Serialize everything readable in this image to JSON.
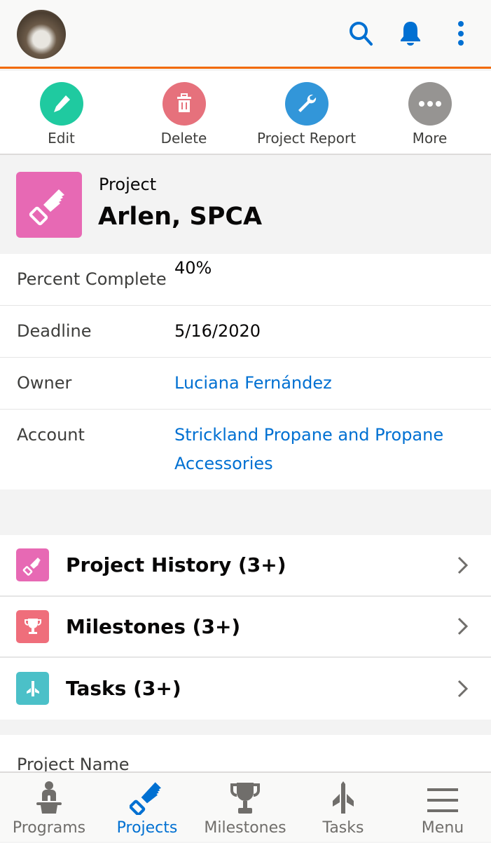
{
  "header": {
    "avatar": "user-avatar-cat",
    "icons": [
      "search-icon",
      "bell-icon",
      "more-vertical-icon"
    ],
    "accent": "#0070d2",
    "bar_color": "#f26a00"
  },
  "actions": [
    {
      "label": "Edit",
      "icon": "pencil-icon",
      "color": "#1fcaa0"
    },
    {
      "label": "Delete",
      "icon": "trash-icon",
      "color": "#e6717c"
    },
    {
      "label": "Project Report",
      "icon": "wrench-icon",
      "color": "#3296d9"
    },
    {
      "label": "More",
      "icon": "ellipsis-icon",
      "color": "#969492"
    }
  ],
  "record": {
    "type": "Project",
    "title": "Arlen, SPCA",
    "icon": "saw-icon",
    "color": "#e769b4"
  },
  "fields": [
    {
      "label": "Percent Complete",
      "value": "40%"
    },
    {
      "label": "Deadline",
      "value": "5/16/2020"
    },
    {
      "label": "Owner",
      "value": "Luciana Fernández",
      "link": true
    },
    {
      "label": "Account",
      "value": "Strickland Propane and Propane Accessories",
      "link": true
    }
  ],
  "related": [
    {
      "title": "Project History (3+)",
      "icon": "saw-icon",
      "color": "#e769b4"
    },
    {
      "title": "Milestones (3+)",
      "icon": "trophy-icon",
      "color": "#ef6e7b"
    },
    {
      "title": "Tasks (3+)",
      "icon": "plane-icon",
      "color": "#4bc0c8"
    }
  ],
  "details": {
    "first_label": "Project Name"
  },
  "nav": [
    {
      "label": "Programs",
      "icon": "podium-icon"
    },
    {
      "label": "Projects",
      "icon": "saw-icon",
      "active": true
    },
    {
      "label": "Milestones",
      "icon": "trophy-icon"
    },
    {
      "label": "Tasks",
      "icon": "plane-icon"
    },
    {
      "label": "Menu",
      "icon": "hamburger-icon"
    }
  ]
}
